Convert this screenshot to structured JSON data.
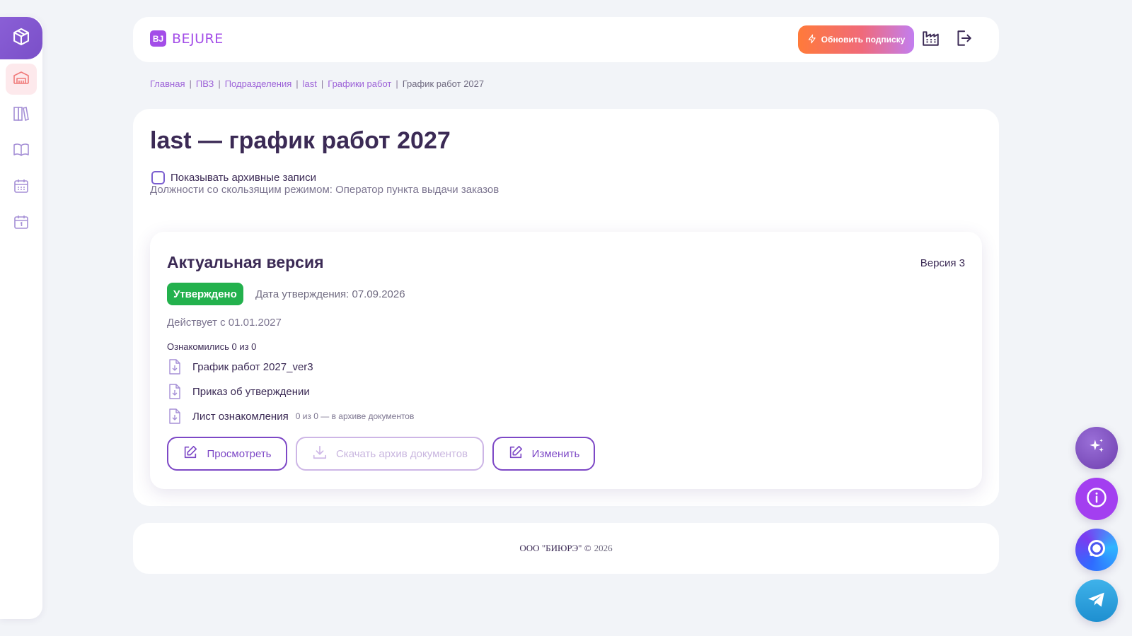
{
  "brand": {
    "mark": "BJ",
    "name": "BEJURE",
    "color": "#a34de8"
  },
  "header": {
    "upgrade_label": "Обновить подписку",
    "icons": [
      "bolt-icon",
      "factory-icon",
      "logout-icon"
    ]
  },
  "sidebar": {
    "items": [
      {
        "icon": "cube-icon",
        "active": false
      },
      {
        "icon": "warehouse-icon",
        "active": true
      },
      {
        "icon": "bookshelf-icon",
        "active": false
      },
      {
        "icon": "book-open-icon",
        "active": false
      },
      {
        "icon": "calendar-grid-icon",
        "active": false
      },
      {
        "icon": "calendar-day-icon",
        "active": false
      }
    ]
  },
  "breadcrumb": {
    "items": [
      "Главная",
      "ПВЗ",
      "Подразделения",
      "last",
      "Графики работ"
    ],
    "current": "График работ 2027",
    "separator": "|"
  },
  "page": {
    "title": "last — график работ 2027",
    "archive_toggle_label": "Показывать архивные записи",
    "archive_checked": false,
    "sliding_positions": "Должности со скользящим режимом: Оператор пункта выдачи заказов"
  },
  "version_card": {
    "title": "Актуальная версия",
    "version": "Версия 3",
    "status": "Утверждено",
    "status_color": "#23b14d",
    "approval_date": "Дата утверждения: 07.09.2026",
    "valid_from": "Действует с 01.01.2027",
    "acquainted": "Ознакомились 0 из 0",
    "documents": [
      {
        "name": "График работ 2027_ver3",
        "note": ""
      },
      {
        "name": "Приказ об утверждении",
        "note": ""
      },
      {
        "name": "Лист ознакомления",
        "note": "0 из 0 — в архиве документов"
      }
    ],
    "buttons": {
      "view": "Просмотреть",
      "download": "Скачать архив документов",
      "edit": "Изменить"
    }
  },
  "footer": {
    "company": "ООО \"БИЮРЭ\" ©",
    "year": "2026"
  },
  "fabs": [
    "sparkle-icon",
    "info-icon",
    "chat-icon",
    "telegram-icon"
  ],
  "colors": {
    "accent": "#7d48c6",
    "background": "#f2f4f8",
    "text": "#3b2a55"
  }
}
